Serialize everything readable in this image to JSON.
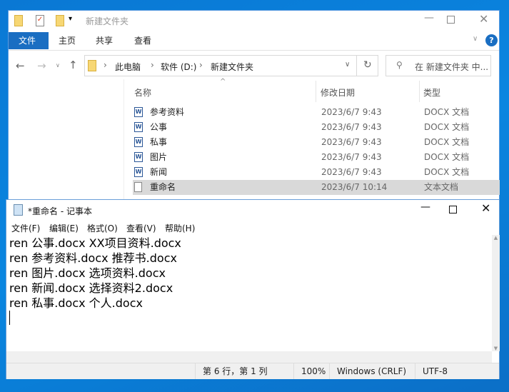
{
  "explorer": {
    "title": "新建文件夹",
    "ribbon_tabs": [
      "文件",
      "主页",
      "共享",
      "查看"
    ],
    "breadcrumb": [
      "此电脑",
      "软件 (D:)",
      "新建文件夹"
    ],
    "search_placeholder": "在 新建文件夹 中...",
    "columns": [
      "名称",
      "修改日期",
      "类型"
    ],
    "files": [
      {
        "name": "参考资料",
        "date": "2023/6/7 9:43",
        "type": "DOCX 文档",
        "icon": "word-doc-icon"
      },
      {
        "name": "公事",
        "date": "2023/6/7 9:43",
        "type": "DOCX 文档",
        "icon": "word-doc-icon"
      },
      {
        "name": "私事",
        "date": "2023/6/7 9:43",
        "type": "DOCX 文档",
        "icon": "word-doc-icon"
      },
      {
        "name": "图片",
        "date": "2023/6/7 9:43",
        "type": "DOCX 文档",
        "icon": "word-doc-icon"
      },
      {
        "name": "新闻",
        "date": "2023/6/7 9:43",
        "type": "DOCX 文档",
        "icon": "word-doc-icon"
      },
      {
        "name": "重命名",
        "date": "2023/6/7 10:14",
        "type": "文本文档",
        "icon": "text-doc-icon"
      }
    ]
  },
  "notepad": {
    "title": "*重命名 - 记事本",
    "menu": [
      "文件(F)",
      "编辑(E)",
      "格式(O)",
      "查看(V)",
      "帮助(H)"
    ],
    "lines": [
      "ren 公事.docx XX项目资料.docx",
      "ren 参考资料.docx 推荐书.docx",
      "ren 图片.docx 选项资料.docx",
      "ren 新闻.docx 选择资料2.docx",
      "ren 私事.docx 个人.docx"
    ],
    "status": {
      "position": "第 6 行，第 1 列",
      "zoom": "100%",
      "line_ending": "Windows (CRLF)",
      "encoding": "UTF-8"
    }
  }
}
